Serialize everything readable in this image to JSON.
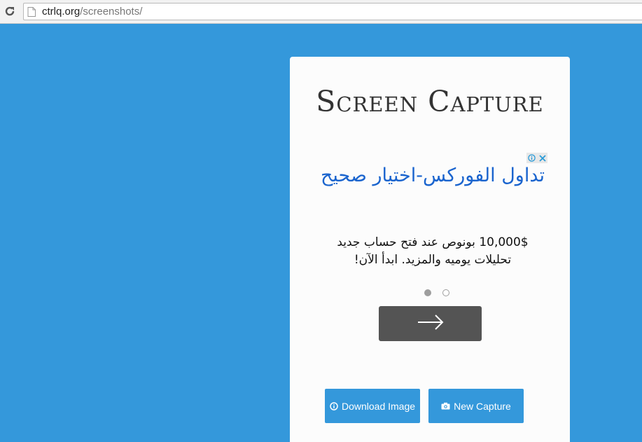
{
  "browser": {
    "url_host": "ctrlq.org",
    "url_path": "/screenshots/",
    "icons": {
      "reload": "reload-icon",
      "page": "page-icon"
    }
  },
  "card": {
    "title": "Screen Capture"
  },
  "ad": {
    "headline": "تداول الفوركس-اختيار صحيح",
    "body_line1": "10,000$ بونوص عند فتح حساب جديد",
    "body_line2": "تحليلات يوميه والمزيد. ابدأ الآن!",
    "badge_icons": [
      "adchoices-icon",
      "close-icon"
    ],
    "carousel": {
      "count": 2,
      "active_index": 0
    },
    "cta_icon": "arrow-right-icon"
  },
  "actions": {
    "download_label": "Download Image",
    "download_icon": "info-icon",
    "capture_label": "New Capture",
    "capture_icon": "camera-icon"
  },
  "colors": {
    "background": "#3498db",
    "button": "#3498db",
    "ad_link": "#1a64ce",
    "cta": "#545454"
  }
}
